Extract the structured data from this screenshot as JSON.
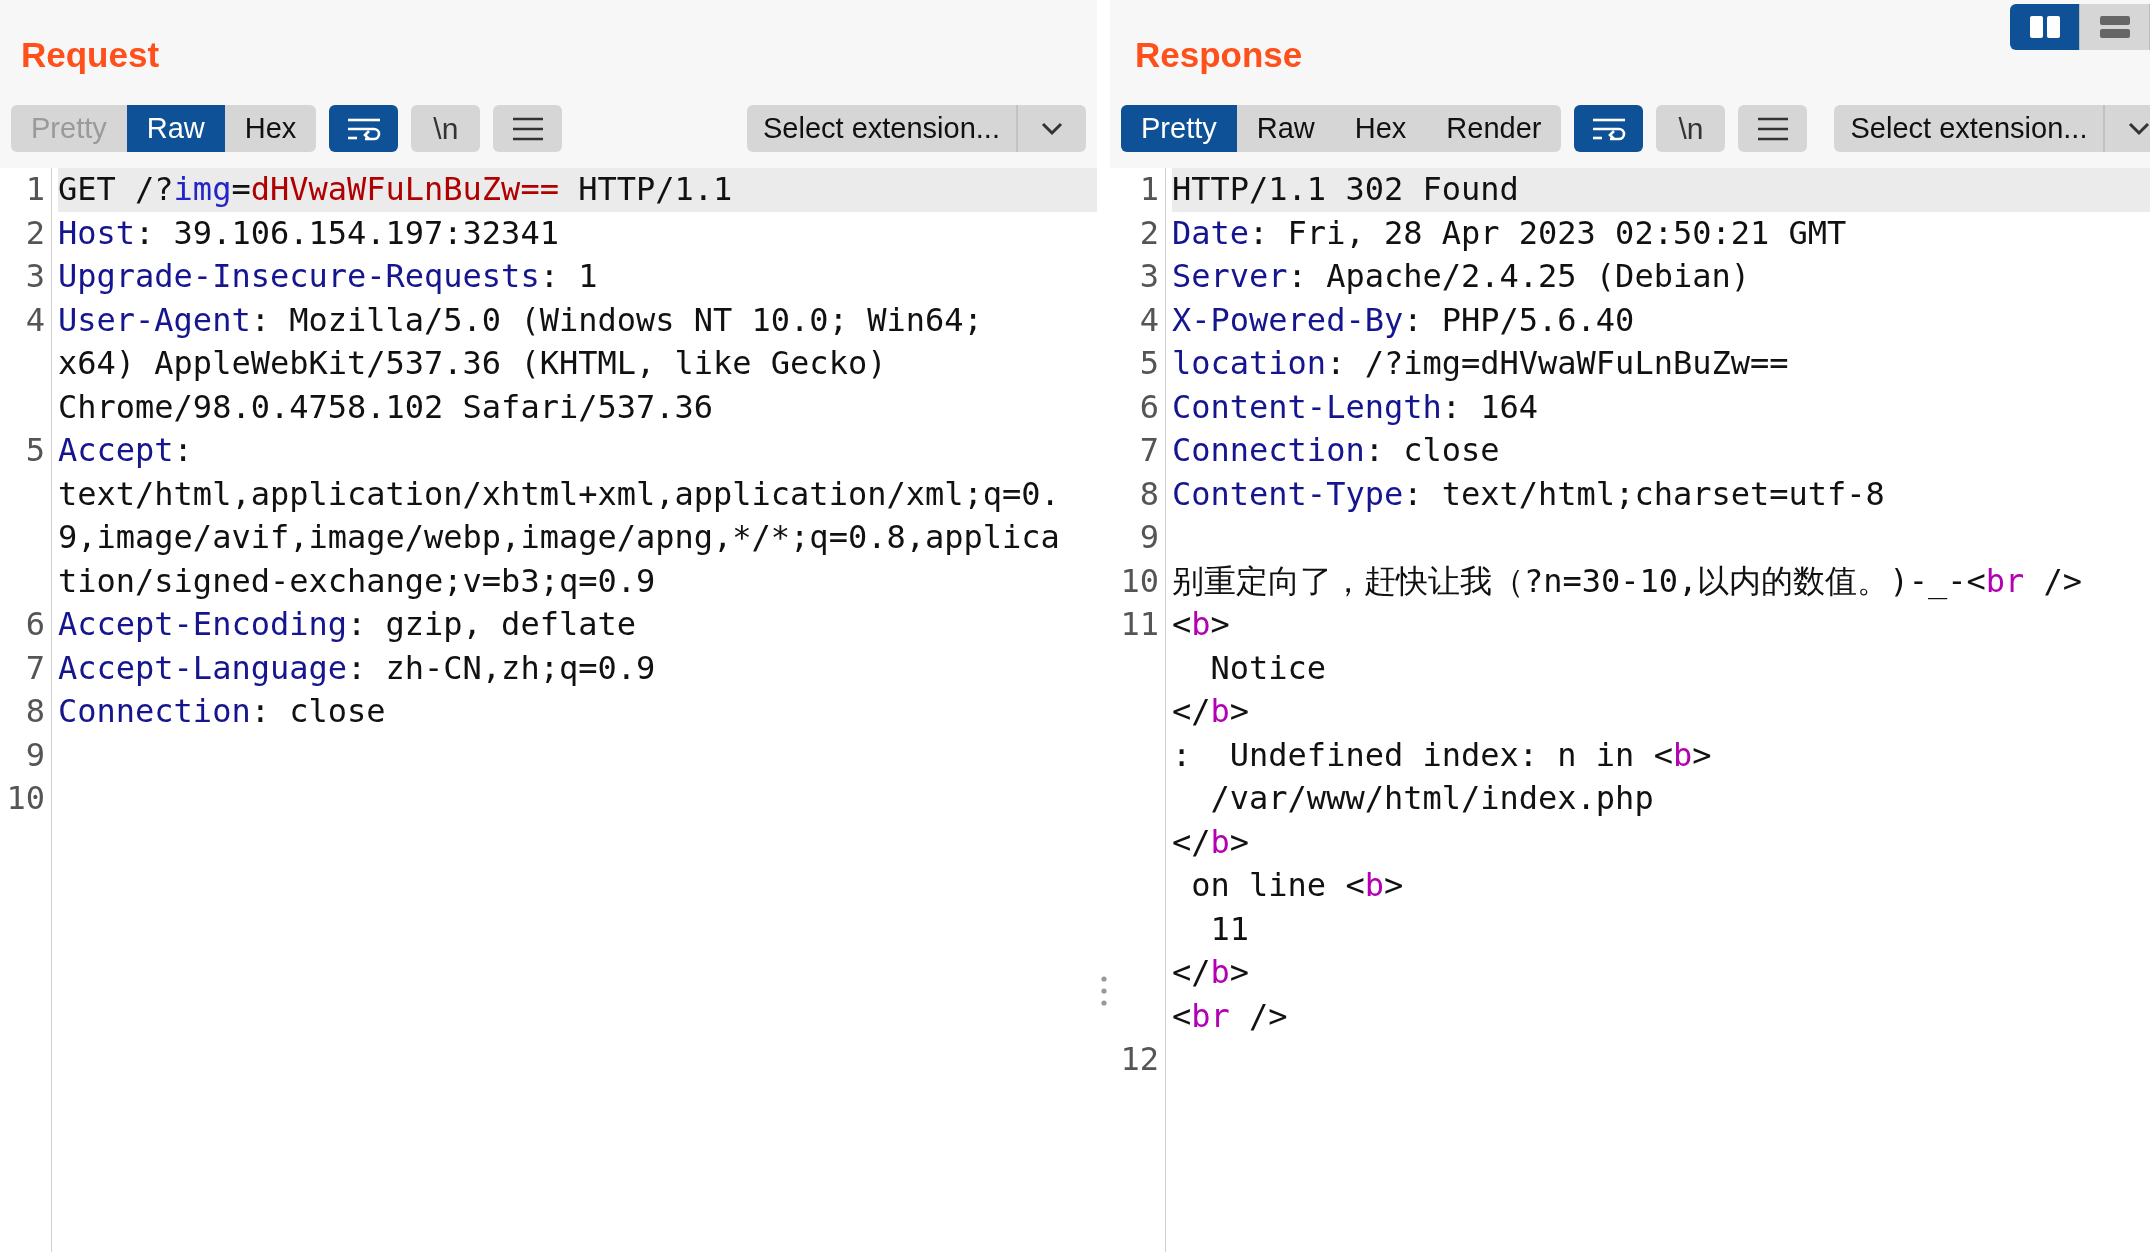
{
  "request": {
    "title": "Request",
    "view_tabs": [
      {
        "label": "Pretty",
        "selected": false,
        "disabled": true
      },
      {
        "label": "Raw",
        "selected": true,
        "disabled": false
      },
      {
        "label": "Hex",
        "selected": false,
        "disabled": false
      }
    ],
    "wrap_toggle": {
      "on": true
    },
    "newline_toggle": {
      "label": "\\n",
      "on": false
    },
    "extension_select": {
      "value": "Select extension..."
    },
    "lines": [
      {
        "number": "1",
        "highlighted": true,
        "rows": [
          {
            "parts": [
              {
                "kind": "text",
                "text": "GET /?"
              },
              {
                "kind": "param",
                "text": "img"
              },
              {
                "kind": "text",
                "text": "="
              },
              {
                "kind": "value",
                "text": "dHVwaWFuLnBuZw=="
              },
              {
                "kind": "text",
                "text": " HTTP/1.1"
              }
            ]
          }
        ]
      },
      {
        "number": "2",
        "highlighted": false,
        "rows": [
          {
            "parts": [
              {
                "kind": "key",
                "text": "Host"
              },
              {
                "kind": "text",
                "text": ": 39.106.154.197:32341"
              }
            ]
          }
        ]
      },
      {
        "number": "3",
        "highlighted": false,
        "rows": [
          {
            "parts": [
              {
                "kind": "key",
                "text": "Upgrade-Insecure-Requests"
              },
              {
                "kind": "text",
                "text": ": 1"
              }
            ]
          }
        ]
      },
      {
        "number": "4",
        "highlighted": false,
        "rows": [
          {
            "parts": [
              {
                "kind": "key",
                "text": "User-Agent"
              },
              {
                "kind": "text",
                "text": ": Mozilla/5.0 (Windows NT 10.0; Win64;"
              }
            ]
          },
          {
            "parts": [
              {
                "kind": "text",
                "text": "x64) AppleWebKit/537.36 (KHTML, like Gecko)"
              }
            ]
          },
          {
            "parts": [
              {
                "kind": "text",
                "text": "Chrome/98.0.4758.102 Safari/537.36"
              }
            ]
          }
        ]
      },
      {
        "number": "5",
        "highlighted": false,
        "rows": [
          {
            "parts": [
              {
                "kind": "key",
                "text": "Accept"
              },
              {
                "kind": "text",
                "text": ":"
              }
            ]
          },
          {
            "parts": [
              {
                "kind": "text",
                "text": "text/html,application/xhtml+xml,application/xml;q=0."
              }
            ]
          },
          {
            "parts": [
              {
                "kind": "text",
                "text": "9,image/avif,image/webp,image/apng,*/*;q=0.8,applica"
              }
            ]
          },
          {
            "parts": [
              {
                "kind": "text",
                "text": "tion/signed-exchange;v=b3;q=0.9"
              }
            ]
          }
        ]
      },
      {
        "number": "6",
        "highlighted": false,
        "rows": [
          {
            "parts": [
              {
                "kind": "key",
                "text": "Accept-Encoding"
              },
              {
                "kind": "text",
                "text": ": gzip, deflate"
              }
            ]
          }
        ]
      },
      {
        "number": "7",
        "highlighted": false,
        "rows": [
          {
            "parts": [
              {
                "kind": "key",
                "text": "Accept-Language"
              },
              {
                "kind": "text",
                "text": ": zh-CN,zh;q=0.9"
              }
            ]
          }
        ]
      },
      {
        "number": "8",
        "highlighted": false,
        "rows": [
          {
            "parts": [
              {
                "kind": "key",
                "text": "Connection"
              },
              {
                "kind": "text",
                "text": ": close"
              }
            ]
          }
        ]
      },
      {
        "number": "9",
        "highlighted": false
      },
      {
        "number": "10",
        "highlighted": false
      }
    ]
  },
  "response": {
    "title": "Response",
    "layout_toggles": [
      {
        "selected": true,
        "kind": "columns"
      },
      {
        "selected": false,
        "kind": "rows"
      }
    ],
    "view_tabs": [
      {
        "label": "Pretty",
        "selected": true,
        "disabled": false
      },
      {
        "label": "Raw",
        "selected": false,
        "disabled": false
      },
      {
        "label": "Hex",
        "selected": false,
        "disabled": false
      },
      {
        "label": "Render",
        "selected": false,
        "disabled": false
      }
    ],
    "wrap_toggle": {
      "on": true
    },
    "newline_toggle": {
      "label": "\\n",
      "on": false
    },
    "extension_select": {
      "value": "Select extension..."
    },
    "lines": [
      {
        "number": "1",
        "highlighted": true,
        "rows": [
          {
            "parts": [
              {
                "kind": "text",
                "text": "HTTP/1.1 302 Found"
              }
            ]
          }
        ]
      },
      {
        "number": "2",
        "highlighted": false,
        "rows": [
          {
            "parts": [
              {
                "kind": "key",
                "text": "Date"
              },
              {
                "kind": "text",
                "text": ": Fri, 28 Apr 2023 02:50:21 GMT"
              }
            ]
          }
        ]
      },
      {
        "number": "3",
        "highlighted": false,
        "rows": [
          {
            "parts": [
              {
                "kind": "key",
                "text": "Server"
              },
              {
                "kind": "text",
                "text": ": Apache/2.4.25 (Debian)"
              }
            ]
          }
        ]
      },
      {
        "number": "4",
        "highlighted": false,
        "rows": [
          {
            "parts": [
              {
                "kind": "key",
                "text": "X-Powered-By"
              },
              {
                "kind": "text",
                "text": ": PHP/5.6.40"
              }
            ]
          }
        ]
      },
      {
        "number": "5",
        "highlighted": false,
        "rows": [
          {
            "parts": [
              {
                "kind": "key",
                "text": "location"
              },
              {
                "kind": "text",
                "text": ": /?img=dHVwaWFuLnBuZw=="
              }
            ]
          }
        ]
      },
      {
        "number": "6",
        "highlighted": false,
        "rows": [
          {
            "parts": [
              {
                "kind": "key",
                "text": "Content-Length"
              },
              {
                "kind": "text",
                "text": ": 164"
              }
            ]
          }
        ]
      },
      {
        "number": "7",
        "highlighted": false,
        "rows": [
          {
            "parts": [
              {
                "kind": "key",
                "text": "Connection"
              },
              {
                "kind": "text",
                "text": ": close"
              }
            ]
          }
        ]
      },
      {
        "number": "8",
        "highlighted": false,
        "rows": [
          {
            "parts": [
              {
                "kind": "key",
                "text": "Content-Type"
              },
              {
                "kind": "text",
                "text": ": text/html;charset=utf-8"
              }
            ]
          }
        ]
      },
      {
        "number": "9",
        "highlighted": false
      },
      {
        "number": "10",
        "highlighted": false,
        "rows": [
          {
            "parts": [
              {
                "kind": "text",
                "text": "别重定向了，赶快让我（?n=30-10,以内的数值。)-_-<"
              },
              {
                "kind": "tag",
                "text": "br"
              },
              {
                "kind": "text",
                "text": " />"
              }
            ]
          }
        ]
      },
      {
        "number": "11",
        "highlighted": false,
        "rows": [
          {
            "parts": [
              {
                "kind": "text",
                "text": "<"
              },
              {
                "kind": "tag",
                "text": "b"
              },
              {
                "kind": "text",
                "text": ">"
              }
            ]
          },
          {
            "parts": [
              {
                "kind": "text",
                "text": "  Notice"
              }
            ]
          },
          {
            "parts": [
              {
                "kind": "text",
                "text": "</"
              },
              {
                "kind": "tag",
                "text": "b"
              },
              {
                "kind": "text",
                "text": ">"
              }
            ]
          },
          {
            "parts": [
              {
                "kind": "text",
                "text": ":  Undefined index: n in <"
              },
              {
                "kind": "tag",
                "text": "b"
              },
              {
                "kind": "text",
                "text": ">"
              }
            ]
          },
          {
            "parts": [
              {
                "kind": "text",
                "text": "  /var/www/html/index.php"
              }
            ]
          },
          {
            "parts": [
              {
                "kind": "text",
                "text": "</"
              },
              {
                "kind": "tag",
                "text": "b"
              },
              {
                "kind": "text",
                "text": ">"
              }
            ]
          },
          {
            "parts": [
              {
                "kind": "text",
                "text": " on line <"
              },
              {
                "kind": "tag",
                "text": "b"
              },
              {
                "kind": "text",
                "text": ">"
              }
            ]
          },
          {
            "parts": [
              {
                "kind": "text",
                "text": "  11"
              }
            ]
          },
          {
            "parts": [
              {
                "kind": "text",
                "text": "</"
              },
              {
                "kind": "tag",
                "text": "b"
              },
              {
                "kind": "text",
                "text": ">"
              }
            ]
          },
          {
            "parts": [
              {
                "kind": "text",
                "text": "<"
              },
              {
                "kind": "tag",
                "text": "br"
              },
              {
                "kind": "text",
                "text": " />"
              }
            ]
          }
        ]
      },
      {
        "number": "12",
        "highlighted": false
      }
    ]
  }
}
